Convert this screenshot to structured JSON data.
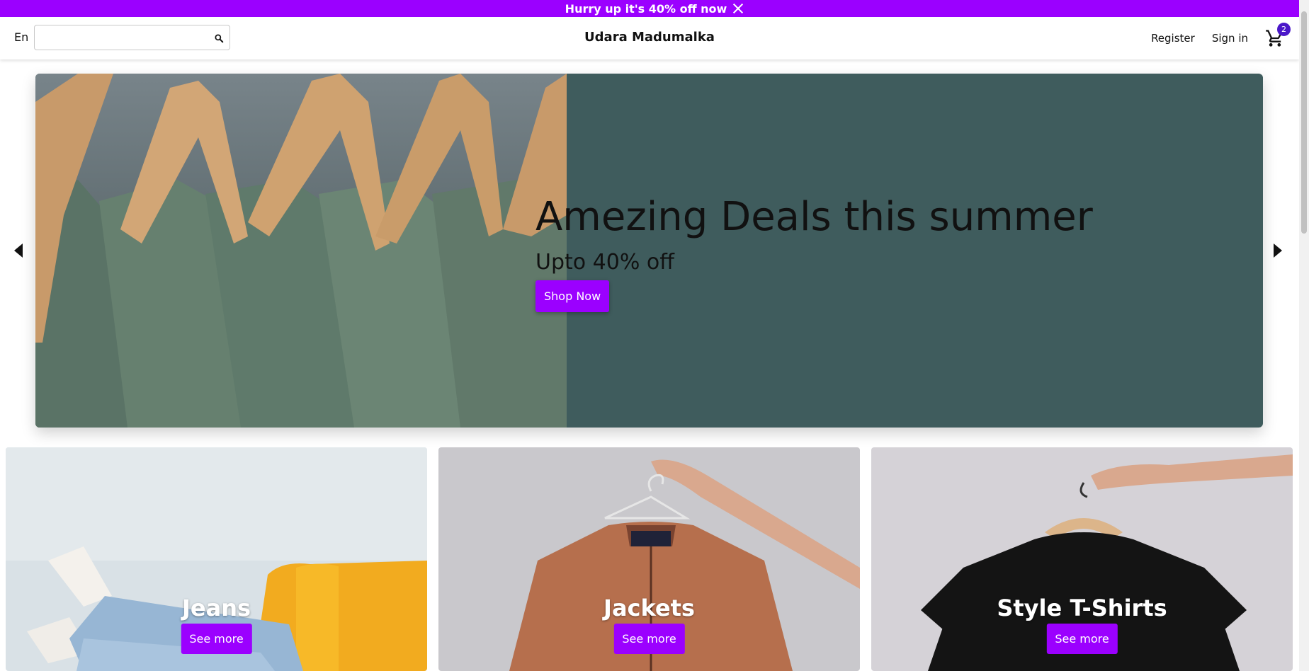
{
  "announcement": {
    "text": "Hurry up it's 40% off now"
  },
  "navbar": {
    "language": "En",
    "search_placeholder": "",
    "brand": "Udara Madumalka",
    "register": "Register",
    "sign_in": "Sign in",
    "cart_count": "2"
  },
  "hero": {
    "title": "Amezing Deals this summer",
    "subtitle": "Upto 40% off",
    "button": "Shop Now",
    "panel_color": "#3f5c5d"
  },
  "categories": [
    {
      "label": "Jeans",
      "button": "See more"
    },
    {
      "label": "Jackets",
      "button": "See more"
    },
    {
      "label": "Style T-Shirts",
      "button": "See more"
    }
  ],
  "colors": {
    "accent": "#9b00ff",
    "badge": "#4b18c9"
  }
}
